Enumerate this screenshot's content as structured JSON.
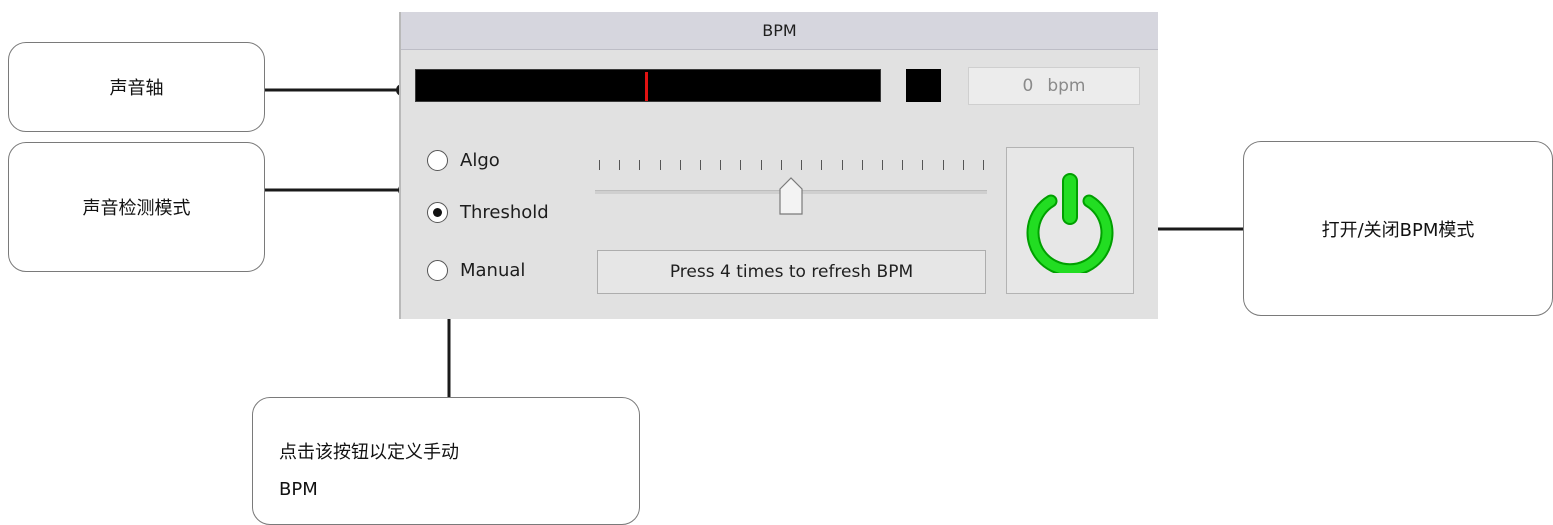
{
  "panel": {
    "title": "BPM",
    "bpm_value": "0",
    "bpm_unit": "bpm",
    "modes": [
      {
        "label": "Algo",
        "selected": false
      },
      {
        "label": "Threshold",
        "selected": true
      },
      {
        "label": "Manual",
        "selected": false
      }
    ],
    "refresh_button_label": "Press 4 times to refresh BPM",
    "power_icon": "power-icon",
    "power_color": "#22dd22",
    "sound_marker_color": "#e01212",
    "slider_level": 0.5
  },
  "callouts": {
    "sound_axis": "声音轴",
    "detection_mode": "声音检测模式",
    "toggle_bpm": "打开/关闭BPM模式",
    "manual_line1": "点击该按钮以定义手动",
    "manual_line2": "BPM"
  }
}
